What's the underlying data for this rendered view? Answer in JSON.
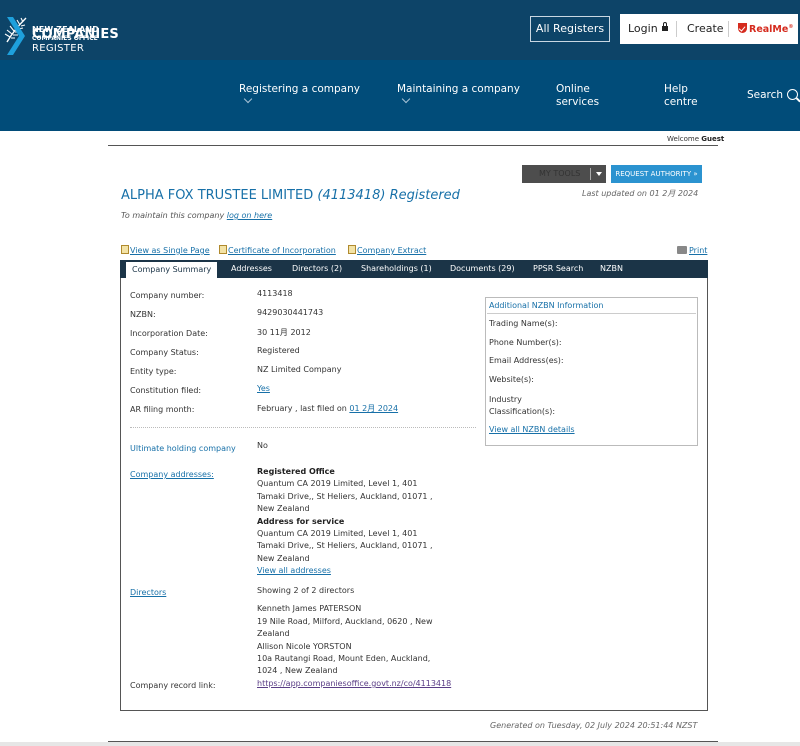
{
  "header": {
    "brand_line1": "NEW ZEALAND",
    "brand_line2": "COMPANIES OFFICE",
    "all_registers": "All Registers",
    "login": "Login",
    "create": "Create",
    "realme": "RealMe",
    "realme_mark": "®"
  },
  "nav": {
    "register_title": "COMPANIES",
    "register_sub": "REGISTER",
    "item_registering": "Registering a company",
    "item_maintaining": "Maintaining a company",
    "item_online_1": "Online",
    "item_online_2": "services",
    "item_help_1": "Help",
    "item_help_2": "centre",
    "item_search": "Search"
  },
  "welcome": {
    "prefix": "Welcome",
    "user": "Guest"
  },
  "buttons": {
    "my_tools": "MY TOOLS",
    "request_authority": "REQUEST AUTHORITY »"
  },
  "company": {
    "name": "ALPHA FOX TRUSTEE LIMITED",
    "number_paren": "(4113418)",
    "status_title": "Registered",
    "last_updated": "Last updated on 01 2月 2024",
    "maintain_prefix": "To maintain this company",
    "maintain_link": "log on here"
  },
  "doc_links": {
    "single_page": "View as Single Page",
    "certificate": "Certificate of Incorporation",
    "extract": "Company Extract",
    "print": "Print"
  },
  "tabs": [
    "Company Summary",
    "Addresses",
    "Directors (2)",
    "Shareholdings (1)",
    "Documents (29)",
    "PPSR Search",
    "NZBN"
  ],
  "summary": {
    "company_number_label": "Company number:",
    "company_number": "4113418",
    "nzbn_label": "NZBN:",
    "nzbn": "9429030441743",
    "incorporation_label": "Incorporation Date:",
    "incorporation": "30 11月 2012",
    "status_label": "Company Status:",
    "status": "Registered",
    "entity_label": "Entity type:",
    "entity": "NZ Limited Company",
    "constitution_label": "Constitution filed:",
    "constitution": "Yes",
    "ar_label": "AR filing month:",
    "ar_value": "February , last filed on",
    "ar_date": "01 2月 2024",
    "ultimate_label": "Ultimate holding company",
    "ultimate": "No",
    "addresses_label": "Company addresses:",
    "reg_office_title": "Registered Office",
    "reg_office_1": "Quantum CA 2019 Limited, Level 1, 401",
    "reg_office_2": "Tamaki Drive,, St Heliers, Auckland, 01071 ,",
    "reg_office_3": "New Zealand",
    "service_title": "Address for service",
    "service_1": "Quantum CA 2019 Limited, Level 1, 401",
    "service_2": "Tamaki Drive,, St Heliers, Auckland, 01071 ,",
    "service_3": "New Zealand",
    "view_addresses": "View all addresses",
    "directors_label": "Directors",
    "directors_showing": "Showing 2 of 2 directors",
    "dir1_name": "Kenneth James PATERSON",
    "dir1_addr1": "19 Nile Road, Milford, Auckland, 0620 , New",
    "dir1_addr2": "Zealand",
    "dir2_name": "Allison Nicole YORSTON",
    "dir2_addr1": "10a Rautangi Road, Mount Eden, Auckland,",
    "dir2_addr2": "1024 , New Zealand",
    "record_link_label": "Company record link:",
    "record_link": "https://app.companiesoffice.govt.nz/co/4113418"
  },
  "nzbn_info": {
    "title": "Additional NZBN Information",
    "trading": "Trading Name(s):",
    "phone": "Phone Number(s):",
    "email": "Email Address(es):",
    "website": "Website(s):",
    "industry_1": "Industry",
    "industry_2": "Classification(s):",
    "view_all": "View all NZBN details"
  },
  "footer": {
    "generated": "Generated on Tuesday, 02 July 2024 20:51:44 NZST"
  }
}
